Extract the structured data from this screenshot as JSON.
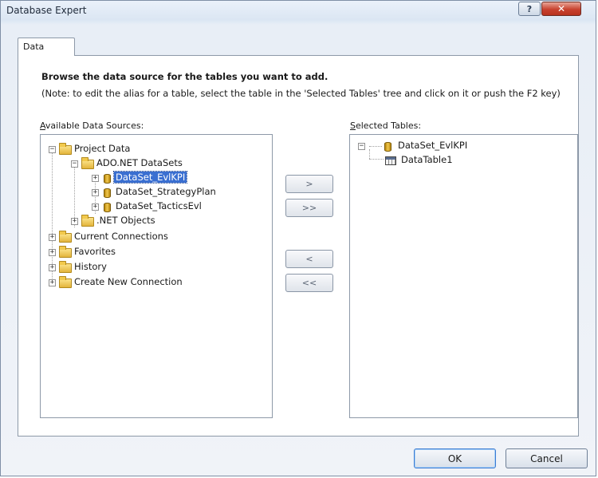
{
  "window": {
    "title": "Database Expert",
    "help_glyph": "?",
    "close_glyph": "✕"
  },
  "tabs": [
    {
      "label": "Data"
    }
  ],
  "content": {
    "heading": "Browse the data source for the tables you want to add.",
    "note": "(Note: to edit the alias for a table, select the table in the 'Selected Tables' tree and click on it or push the F2 key)"
  },
  "available": {
    "label_access": "A",
    "label_rest": "vailable Data Sources:",
    "nodes": [
      {
        "label": "Project Data",
        "expander": "−",
        "icon": "folder-icon"
      },
      {
        "label": "ADO.NET DataSets",
        "expander": "−",
        "icon": "folder-icon"
      },
      {
        "label": "DataSet_EvlKPI",
        "expander": "+",
        "icon": "database-icon",
        "selected": true
      },
      {
        "label": "DataSet_StrategyPlan",
        "expander": "+",
        "icon": "database-icon"
      },
      {
        "label": "DataSet_TacticsEvl",
        "expander": "+",
        "icon": "database-icon"
      },
      {
        "label": ".NET Objects",
        "expander": "+",
        "icon": "folder-icon"
      },
      {
        "label": "Current Connections",
        "expander": "+",
        "icon": "folder-icon"
      },
      {
        "label": "Favorites",
        "expander": "+",
        "icon": "folder-icon"
      },
      {
        "label": "History",
        "expander": "+",
        "icon": "folder-icon"
      },
      {
        "label": "Create New Connection",
        "expander": "+",
        "icon": "folder-icon"
      }
    ]
  },
  "selected_tables": {
    "label_access": "S",
    "label_rest": "elected Tables:",
    "nodes": [
      {
        "label": "DataSet_EvlKPI",
        "expander": "−",
        "icon": "database-icon"
      },
      {
        "label": "DataTable1",
        "icon": "table-icon"
      }
    ]
  },
  "move_buttons": {
    "add_one": ">",
    "add_all": ">>",
    "remove_one": "<",
    "remove_all": "<<"
  },
  "footer": {
    "ok": "OK",
    "cancel": "Cancel"
  }
}
